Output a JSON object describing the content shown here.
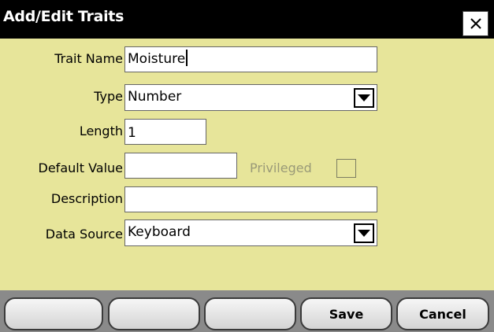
{
  "window": {
    "title": "Add/Edit Traits",
    "close_icon": "close-icon (×)"
  },
  "form": {
    "trait_name": {
      "label": "Trait Name",
      "value": "Moisture"
    },
    "type": {
      "label": "Type",
      "value": "Number"
    },
    "length": {
      "label": "Length",
      "value": "1"
    },
    "default_value": {
      "label": "Default Value",
      "value": ""
    },
    "privileged": {
      "label": "Privileged",
      "checked": false
    },
    "description": {
      "label": "Description",
      "value": ""
    },
    "data_source": {
      "label": "Data Source",
      "value": "Keyboard"
    }
  },
  "buttons": {
    "blank_1": "",
    "blank_2": "",
    "blank_3": "",
    "save": "Save",
    "cancel": "Cancel"
  },
  "colors": {
    "panel_bg": "#e7e59a",
    "titlebar_bg": "#000000",
    "buttonbar_bg": "#8a8a8a",
    "disabled_text": "#9a9a78"
  }
}
